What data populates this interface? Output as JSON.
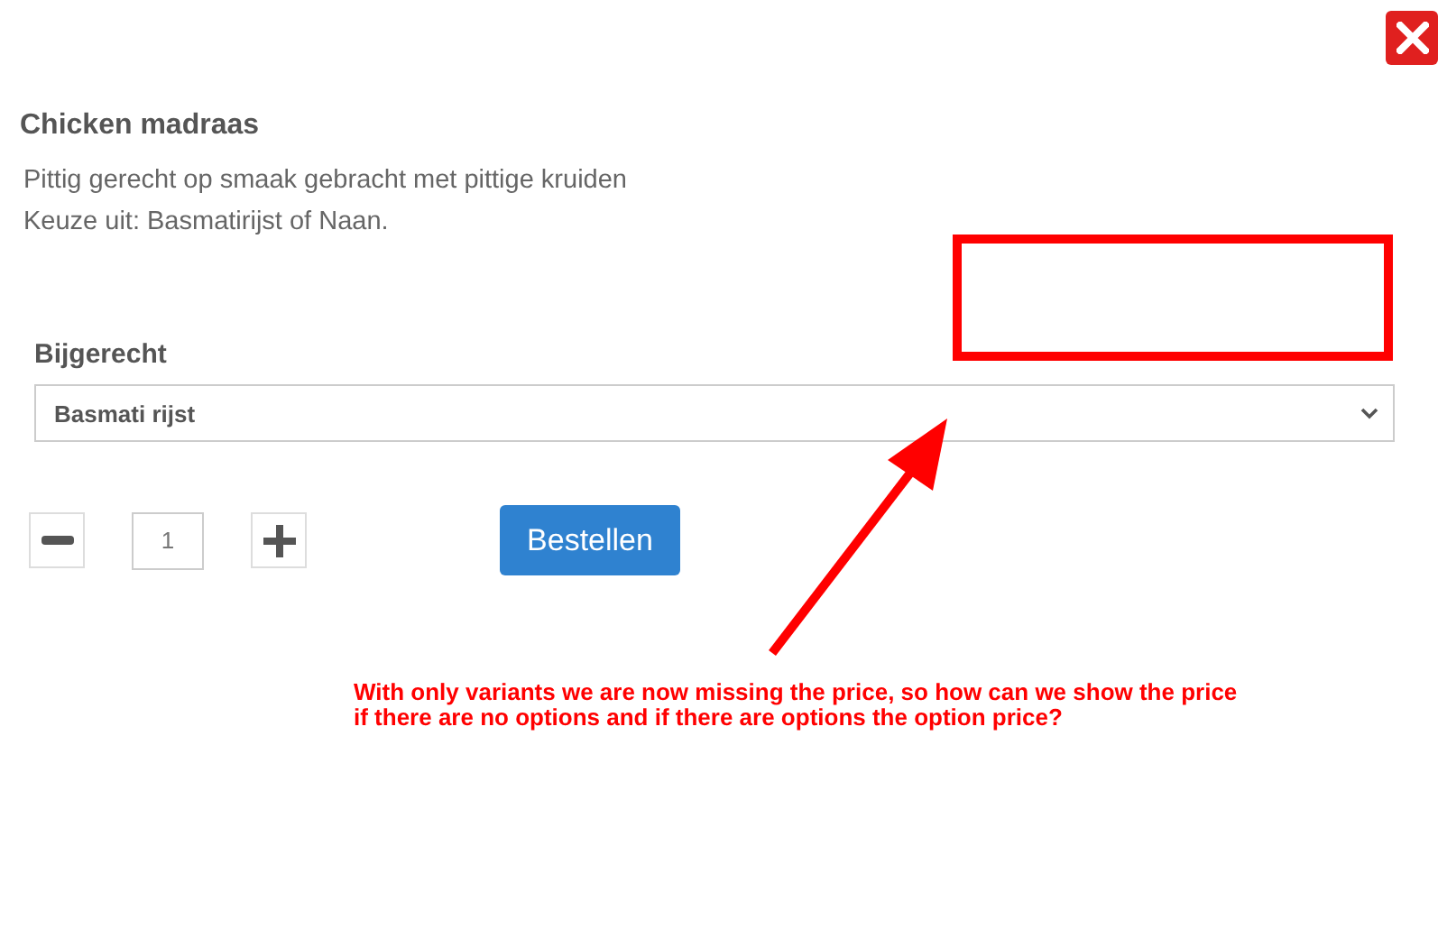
{
  "dialog": {
    "title": "Chicken madraas",
    "description": [
      "Pittig gerecht op smaak gebracht met pittige kruiden",
      "Keuze uit: Basmatirijst of Naan."
    ]
  },
  "side_dish": {
    "label": "Bijgerecht",
    "value": "Basmati rijst"
  },
  "quantity": {
    "value": "1"
  },
  "order_button": "Bestellen",
  "annotation": {
    "note": "With only variants we are now missing the price, so how can we show the price if there are no options and if there are options the option price?"
  }
}
